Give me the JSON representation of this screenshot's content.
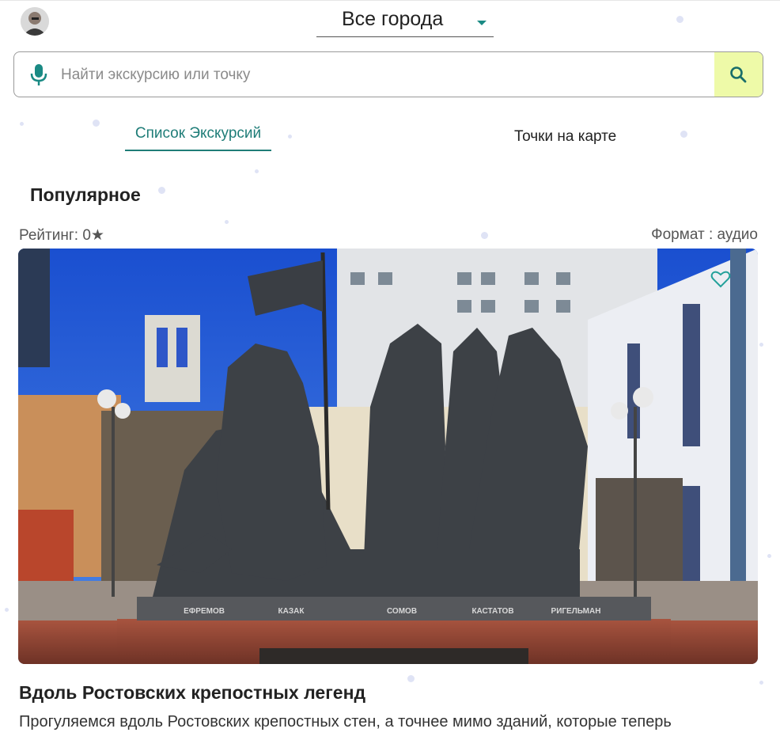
{
  "header": {
    "avatar_icon": "user-avatar-icon",
    "city_selector": {
      "selected": "Все города"
    }
  },
  "search": {
    "placeholder": "Найти экскурсию или точку",
    "value": "",
    "mic_icon": "microphone-icon",
    "search_icon": "search-icon",
    "button_color": "#eefaa8"
  },
  "tabs": [
    {
      "label": "Список Экскурсий",
      "active": true
    },
    {
      "label": "Точки на карте",
      "active": false
    }
  ],
  "section": {
    "title": "Популярное"
  },
  "card": {
    "rating_label": "Рейтинг: 0★",
    "format_label": "Формат : аудио",
    "favorite_icon": "heart-outline-icon",
    "title": "Вдоль Ростовских крепостных легенд",
    "description": "Прогуляемся вдоль Ростовских крепостных стен, а точнее мимо зданий, которые теперь",
    "statue_names": [
      "ЕФРЕМОВ",
      "КАЗАК",
      "СОМОВ",
      "КАСТАТОВ",
      "РИГЕЛЬМАН"
    ]
  },
  "colors": {
    "accent": "#1f7d78",
    "search_button": "#eefaa8"
  }
}
